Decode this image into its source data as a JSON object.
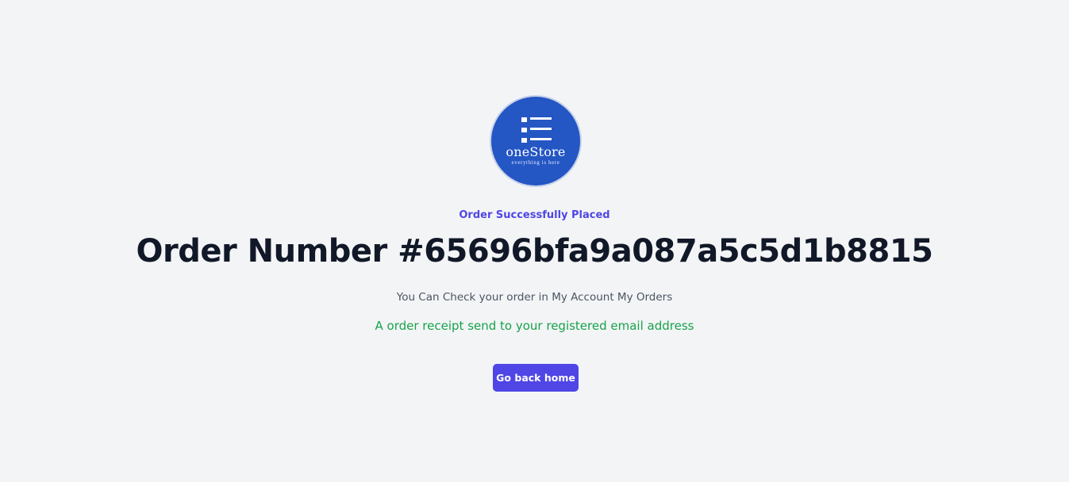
{
  "logo": {
    "name": "oneStore",
    "tagline": "everything is here"
  },
  "status": "Order Successfully Placed",
  "order_number": "Order Number #65696bfa9a087a5c5d1b8815",
  "check_message": "You Can Check your order in My Account My Orders",
  "receipt_message": "A order receipt send to your registered email address",
  "home_button_label": "Go back home",
  "colors": {
    "background": "#f3f4f6",
    "accent": "#4f46e5",
    "logo_blue": "#2456c4",
    "success_green": "#16a34a",
    "heading": "#111827"
  },
  "icons": {
    "logo_icon": "list-icon"
  }
}
